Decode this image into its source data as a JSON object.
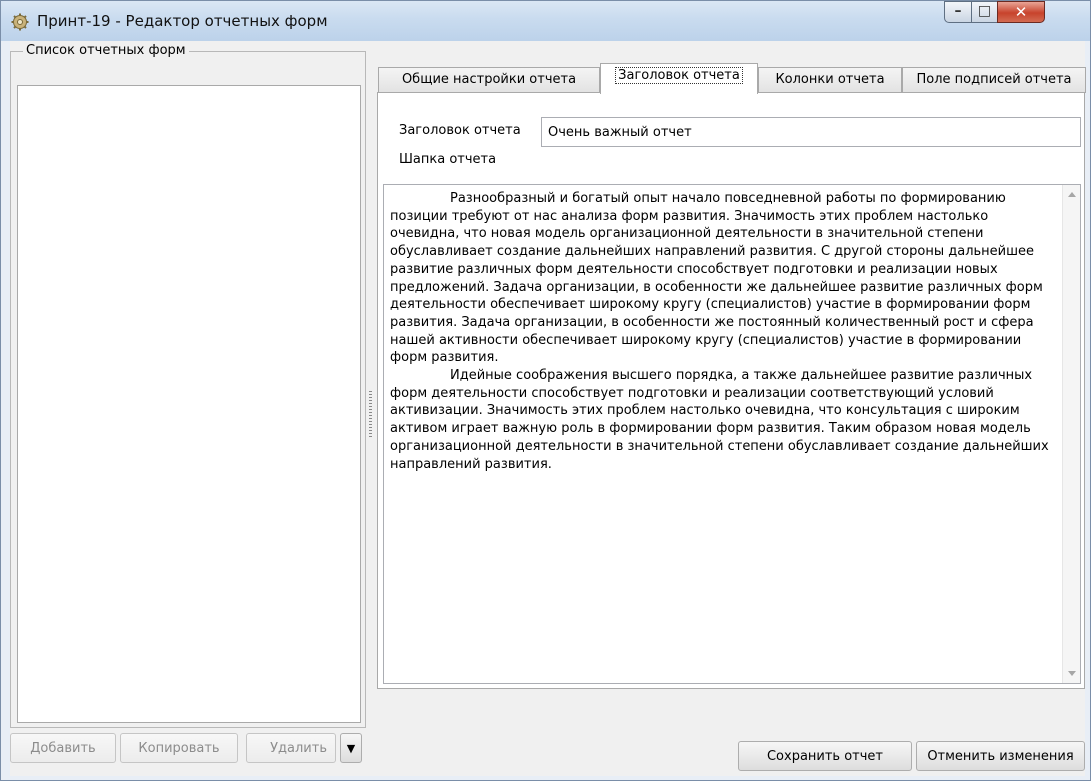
{
  "window": {
    "title": "Принт-19 - Редактор отчетных форм",
    "min_glyph": "–",
    "max_glyph": "□",
    "close_glyph": "✕"
  },
  "left_panel": {
    "group_title": "Список отчетных форм",
    "buttons": {
      "add": "Добавить",
      "copy": "Копировать",
      "delete": "Удалить",
      "dropdown": "▼"
    }
  },
  "tabs": [
    {
      "label": "Общие настройки отчета"
    },
    {
      "label": "Заголовок отчета"
    },
    {
      "label": "Колонки отчета"
    },
    {
      "label": "Поле подписей отчета"
    }
  ],
  "tab_page": {
    "title_label": "Заголовок отчета",
    "title_value": "Очень важный отчет",
    "header_label": "Шапка отчета",
    "header_paragraphs": [
      "Разнообразный и богатый опыт начало повседневной работы по формированию позиции требуют от нас анализа форм развития. Значимость этих проблем настолько очевидна, что новая модель организационной деятельности в значительной степени обуславливает создание дальнейших направлений развития. С другой стороны дальнейшее развитие различных форм деятельности способствует подготовки и реализации новых предложений. Задача организации, в особенности же дальнейшее развитие различных форм деятельности обеспечивает широкому кругу (специалистов) участие в формировании форм развития. Задача организации, в особенности же постоянный количественный рост и сфера нашей активности обеспечивает широкому кругу (специалистов) участие в формировании форм развития.",
      "Идейные соображения высшего порядка, а также дальнейшее развитие различных форм деятельности способствует подготовки и реализации соответствующий условий активизации. Значимость этих проблем настолько очевидна, что консультация с широким активом играет важную роль в формировании форм развития. Таким образом новая модель организационной деятельности в значительной степени обуславливает создание дальнейших направлений развития."
    ]
  },
  "footer": {
    "save": "Сохранить отчет",
    "cancel": "Отменить изменения"
  }
}
